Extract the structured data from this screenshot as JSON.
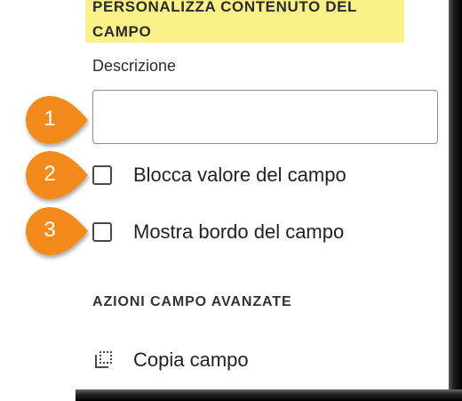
{
  "section": {
    "title": "PERSONALIZZA CONTENUTO DEL CAMPO"
  },
  "description": {
    "label": "Descrizione",
    "value": "",
    "placeholder": ""
  },
  "options": [
    {
      "label": "Blocca valore del campo",
      "checked": false
    },
    {
      "label": "Mostra bordo del campo",
      "checked": false
    }
  ],
  "advanced": {
    "title": "AZIONI CAMPO AVANZATE",
    "copy_label": "Copia campo",
    "copy_icon": "copy-field-icon"
  },
  "callouts": [
    "1",
    "2",
    "3"
  ],
  "colors": {
    "callout": "#f28a1f",
    "highlight": "#faf289"
  }
}
